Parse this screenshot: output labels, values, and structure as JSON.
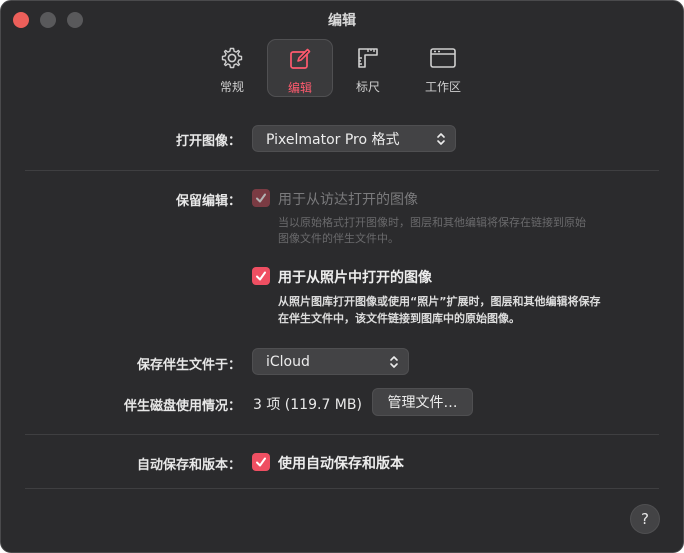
{
  "window": {
    "title": "编辑"
  },
  "toolbar": {
    "tabs": [
      {
        "label": "常规",
        "icon": "gear-icon"
      },
      {
        "label": "编辑",
        "icon": "edit-square-icon",
        "active": true
      },
      {
        "label": "标尺",
        "icon": "ruler-icon"
      },
      {
        "label": "工作区",
        "icon": "workspace-window-icon"
      }
    ]
  },
  "open_image": {
    "label": "打开图像：",
    "value": "Pixelmator Pro 格式"
  },
  "preserve_edits": {
    "label": "保留编辑：",
    "finder": {
      "label": "用于从访达打开的图像",
      "checked": true,
      "enabled": false,
      "desc_line1": "当以原始格式打开图像时，图层和其他编辑将保存在链接到原始",
      "desc_line2": "图像文件的伴生文件中。"
    },
    "photos": {
      "label": "用于从照片中打开的图像",
      "checked": true,
      "enabled": true,
      "desc_line1": "从照片图库打开图像或使用“照片”扩展时，图层和其他编辑将保存",
      "desc_line2": "在伴生文件中，该文件链接到图库中的原始图像。"
    }
  },
  "sidecar": {
    "save_label": "保存伴生文件于：",
    "save_value": "iCloud",
    "usage_label": "伴生磁盘使用情况：",
    "usage_value": "3 项 (119.7 MB)",
    "manage_button": "管理文件…"
  },
  "autosave": {
    "label": "自动保存和版本：",
    "checkbox_label": "使用自动保存和版本",
    "checked": true
  },
  "help": {
    "label": "?"
  },
  "colors": {
    "accent": "#ef4f62",
    "background": "#2b2b2d"
  }
}
